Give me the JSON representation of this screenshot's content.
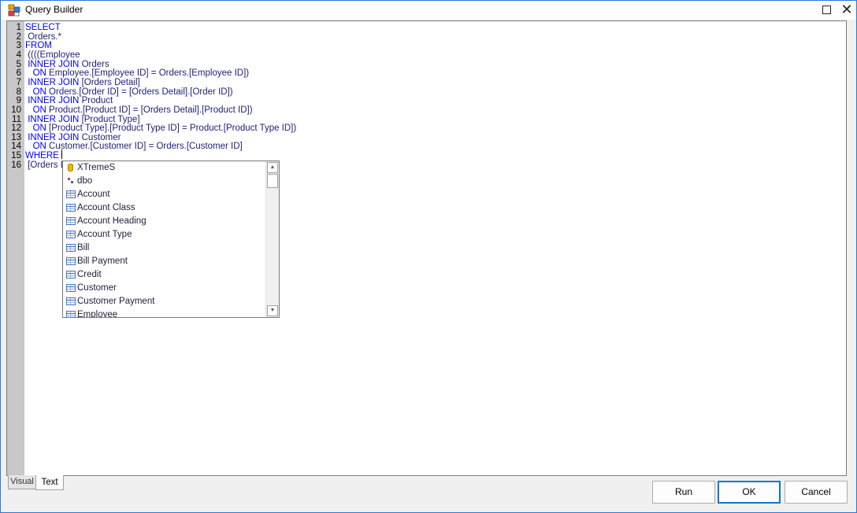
{
  "window": {
    "title": "Query Builder",
    "accent_color": "#2b79d7"
  },
  "editor": {
    "line_numbers": [
      "1",
      "2",
      "3",
      "4",
      "5",
      "6",
      "7",
      "8",
      "9",
      "10",
      "11",
      "12",
      "13",
      "14",
      "15",
      "16"
    ],
    "lines": [
      [
        {
          "t": "SELECT",
          "k": "kw"
        }
      ],
      [
        {
          "t": " Orders.*",
          "k": "id"
        }
      ],
      [
        {
          "t": "FROM",
          "k": "kw"
        }
      ],
      [
        {
          "t": " ((((Employee",
          "k": "id"
        }
      ],
      [
        {
          "t": " INNER JOIN",
          "k": "kw"
        },
        {
          "t": " Orders",
          "k": "id"
        }
      ],
      [
        {
          "t": "   ON",
          "k": "kw"
        },
        {
          "t": " Employee.[Employee ID] = Orders.[Employee ID])",
          "k": "id"
        }
      ],
      [
        {
          "t": " INNER JOIN",
          "k": "kw"
        },
        {
          "t": " [Orders Detail]",
          "k": "id"
        }
      ],
      [
        {
          "t": "   ON",
          "k": "kw"
        },
        {
          "t": " Orders.[Order ID] = [Orders Detail].[Order ID])",
          "k": "id"
        }
      ],
      [
        {
          "t": " INNER JOIN",
          "k": "kw"
        },
        {
          "t": " Product",
          "k": "id"
        }
      ],
      [
        {
          "t": "   ON",
          "k": "kw"
        },
        {
          "t": " Product.[Product ID] = [Orders Detail].[Product ID])",
          "k": "id"
        }
      ],
      [
        {
          "t": " INNER JOIN",
          "k": "kw"
        },
        {
          "t": " [Product Type]",
          "k": "id"
        }
      ],
      [
        {
          "t": "   ON",
          "k": "kw"
        },
        {
          "t": " [Product Type].[Product Type ID] = Product.[Product Type ID])",
          "k": "id"
        }
      ],
      [
        {
          "t": " INNER JOIN",
          "k": "kw"
        },
        {
          "t": " Customer",
          "k": "id"
        }
      ],
      [
        {
          "t": "   ON",
          "k": "kw"
        },
        {
          "t": " Customer.[Customer ID] = Orders.[Customer ID]",
          "k": "id"
        }
      ],
      [
        {
          "t": "WHERE",
          "k": "kw"
        }
      ],
      [
        {
          "t": " [Orders D",
          "k": "id"
        }
      ]
    ]
  },
  "autocomplete": {
    "items": [
      {
        "label": "XTremeS",
        "icon": "database-icon"
      },
      {
        "label": "dbo",
        "icon": "schema-icon"
      },
      {
        "label": "Account",
        "icon": "table-icon"
      },
      {
        "label": "Account Class",
        "icon": "table-icon"
      },
      {
        "label": "Account Heading",
        "icon": "table-icon"
      },
      {
        "label": "Account Type",
        "icon": "table-icon"
      },
      {
        "label": "Bill",
        "icon": "table-icon"
      },
      {
        "label": "Bill Payment",
        "icon": "table-icon"
      },
      {
        "label": "Credit",
        "icon": "table-icon"
      },
      {
        "label": "Customer",
        "icon": "table-icon"
      },
      {
        "label": "Customer Payment",
        "icon": "table-icon"
      },
      {
        "label": "Employee",
        "icon": "table-icon"
      }
    ]
  },
  "tabs": {
    "visual_label": "Visual",
    "text_label": "Text",
    "active": "Text"
  },
  "buttons": {
    "run_label": "Run",
    "ok_label": "OK",
    "cancel_label": "Cancel"
  },
  "colors": {
    "keyword": "#0000ff",
    "identifier": "#1e1e7a",
    "gutter": "#c8c8c8",
    "default_button_border": "#0078d7"
  }
}
